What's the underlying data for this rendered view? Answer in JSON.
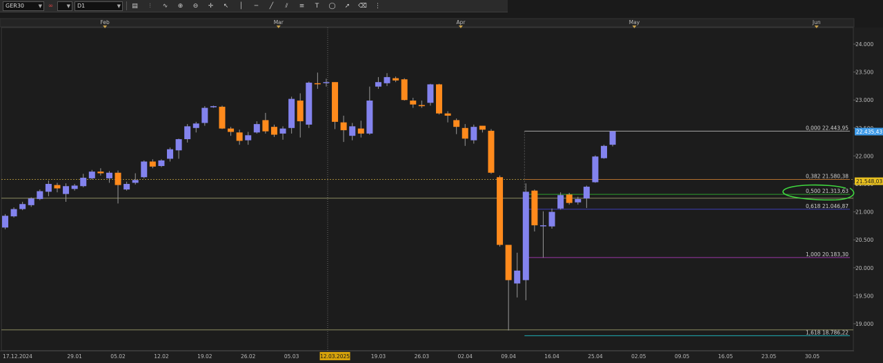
{
  "toolbar": {
    "symbol": "GER30",
    "compare_value": "",
    "timeframe": "D1",
    "tools": [
      {
        "name": "chart-type-icon",
        "glyph": "▤"
      },
      {
        "name": "indicators-icon",
        "glyph": "⫶"
      },
      {
        "name": "oscillators-icon",
        "glyph": "∿"
      },
      {
        "name": "zoom-in-icon",
        "glyph": "⊕"
      },
      {
        "name": "zoom-out-icon",
        "glyph": "⊖"
      },
      {
        "name": "crosshair-icon",
        "glyph": "✛"
      },
      {
        "name": "cursor-icon",
        "glyph": "↖"
      },
      {
        "name": "vertical-line-icon",
        "glyph": "│"
      },
      {
        "name": "horizontal-line-icon",
        "glyph": "─"
      },
      {
        "name": "trend-line-icon",
        "glyph": "╱"
      },
      {
        "name": "channel-icon",
        "glyph": "⫽"
      },
      {
        "name": "fibonacci-icon",
        "glyph": "≡"
      },
      {
        "name": "text-icon",
        "glyph": "T"
      },
      {
        "name": "shapes-icon",
        "glyph": "◯"
      },
      {
        "name": "arrow-icon",
        "glyph": "➚"
      },
      {
        "name": "eraser-icon",
        "glyph": "⌫"
      },
      {
        "name": "more-icon",
        "glyph": "⋮"
      }
    ]
  },
  "chart_data": {
    "type": "candlestick",
    "symbol": "GER30",
    "timeframe": "D1",
    "ylim": [
      18800,
      24200
    ],
    "y_ticks": [
      19000,
      19500,
      20000,
      20500,
      21000,
      21500,
      22000,
      22500,
      23000,
      23500,
      24000
    ],
    "y_tick_labels": [
      "19.000",
      "19.500",
      "20.000",
      "20.500",
      "21.000",
      "21.500",
      "22.000",
      "22.500",
      "23.000",
      "23.500",
      "24.000"
    ],
    "x_labels": [
      "17.12.2024",
      "29.01",
      "05.02",
      "12.02",
      "19.02",
      "26.02",
      "05.03",
      "12.03.2025",
      "19.03",
      "26.03",
      "02.04",
      "09.04",
      "16.04",
      "25.04",
      "02.05",
      "09.05",
      "16.05",
      "23.05",
      "30.05"
    ],
    "x_label_bars": [
      0,
      8,
      13,
      18,
      23,
      28,
      33,
      38,
      43,
      48,
      53,
      58,
      63,
      68,
      73,
      78,
      83,
      88,
      93
    ],
    "highlighted_x_label": "12.03.2025",
    "month_labels": [
      "Feb",
      "Mar",
      "Apr",
      "May",
      "Jun"
    ],
    "month_bars": [
      11.5,
      31.5,
      52.5,
      72.5,
      93.5
    ],
    "bull_color": "#8383ee",
    "bear_color": "#ff8a1c",
    "candles": [
      {
        "o": 20720,
        "h": 20960,
        "l": 20690,
        "c": 20930
      },
      {
        "o": 20920,
        "h": 21080,
        "l": 20900,
        "c": 21050
      },
      {
        "o": 21050,
        "h": 21180,
        "l": 21030,
        "c": 21140
      },
      {
        "o": 21120,
        "h": 21260,
        "l": 21090,
        "c": 21240
      },
      {
        "o": 21230,
        "h": 21400,
        "l": 21210,
        "c": 21370
      },
      {
        "o": 21360,
        "h": 21560,
        "l": 21280,
        "c": 21500
      },
      {
        "o": 21480,
        "h": 21520,
        "l": 21350,
        "c": 21420
      },
      {
        "o": 21320,
        "h": 21510,
        "l": 21180,
        "c": 21460
      },
      {
        "o": 21410,
        "h": 21500,
        "l": 21380,
        "c": 21470
      },
      {
        "o": 21460,
        "h": 21680,
        "l": 21440,
        "c": 21610
      },
      {
        "o": 21600,
        "h": 21750,
        "l": 21580,
        "c": 21720
      },
      {
        "o": 21720,
        "h": 21780,
        "l": 21650,
        "c": 21690
      },
      {
        "o": 21600,
        "h": 21730,
        "l": 21520,
        "c": 21700
      },
      {
        "o": 21700,
        "h": 21740,
        "l": 21150,
        "c": 21480
      },
      {
        "o": 21400,
        "h": 21540,
        "l": 21380,
        "c": 21500
      },
      {
        "o": 21520,
        "h": 21690,
        "l": 21490,
        "c": 21570
      },
      {
        "o": 21620,
        "h": 21920,
        "l": 21600,
        "c": 21900
      },
      {
        "o": 21900,
        "h": 21940,
        "l": 21780,
        "c": 21810
      },
      {
        "o": 21820,
        "h": 21940,
        "l": 21800,
        "c": 21920
      },
      {
        "o": 21950,
        "h": 22150,
        "l": 21900,
        "c": 22120
      },
      {
        "o": 22100,
        "h": 22310,
        "l": 21950,
        "c": 22300
      },
      {
        "o": 22300,
        "h": 22570,
        "l": 22240,
        "c": 22530
      },
      {
        "o": 22500,
        "h": 22610,
        "l": 22420,
        "c": 22580
      },
      {
        "o": 22590,
        "h": 22890,
        "l": 22540,
        "c": 22860
      },
      {
        "o": 22870,
        "h": 22900,
        "l": 22860,
        "c": 22890
      },
      {
        "o": 22880,
        "h": 22900,
        "l": 22480,
        "c": 22490
      },
      {
        "o": 22490,
        "h": 22520,
        "l": 22360,
        "c": 22430
      },
      {
        "o": 22420,
        "h": 22470,
        "l": 22200,
        "c": 22270
      },
      {
        "o": 22280,
        "h": 22430,
        "l": 22200,
        "c": 22370
      },
      {
        "o": 22420,
        "h": 22620,
        "l": 22400,
        "c": 22570
      },
      {
        "o": 22640,
        "h": 22770,
        "l": 22400,
        "c": 22440
      },
      {
        "o": 22520,
        "h": 22560,
        "l": 22340,
        "c": 22380
      },
      {
        "o": 22400,
        "h": 22530,
        "l": 22290,
        "c": 22490
      },
      {
        "o": 22500,
        "h": 23060,
        "l": 22400,
        "c": 23020
      },
      {
        "o": 22990,
        "h": 23120,
        "l": 22330,
        "c": 22620
      },
      {
        "o": 22560,
        "h": 23330,
        "l": 22500,
        "c": 23310
      },
      {
        "o": 23300,
        "h": 23490,
        "l": 23200,
        "c": 23290
      },
      {
        "o": 23310,
        "h": 23380,
        "l": 23240,
        "c": 23320
      },
      {
        "o": 23320,
        "h": 23320,
        "l": 22480,
        "c": 22610
      },
      {
        "o": 22600,
        "h": 22720,
        "l": 22250,
        "c": 22460
      },
      {
        "o": 22360,
        "h": 22590,
        "l": 22280,
        "c": 22530
      },
      {
        "o": 22490,
        "h": 22630,
        "l": 22330,
        "c": 22400
      },
      {
        "o": 22400,
        "h": 23240,
        "l": 22380,
        "c": 22990
      },
      {
        "o": 23240,
        "h": 23410,
        "l": 23200,
        "c": 23320
      },
      {
        "o": 23300,
        "h": 23480,
        "l": 23250,
        "c": 23410
      },
      {
        "o": 23390,
        "h": 23420,
        "l": 23320,
        "c": 23350
      },
      {
        "o": 23370,
        "h": 23390,
        "l": 22990,
        "c": 23000
      },
      {
        "o": 22990,
        "h": 23040,
        "l": 22860,
        "c": 22920
      },
      {
        "o": 22910,
        "h": 22990,
        "l": 22860,
        "c": 22890
      },
      {
        "o": 22950,
        "h": 23290,
        "l": 22900,
        "c": 23280
      },
      {
        "o": 23280,
        "h": 23290,
        "l": 22740,
        "c": 22760
      },
      {
        "o": 22760,
        "h": 22800,
        "l": 22600,
        "c": 22720
      },
      {
        "o": 22640,
        "h": 22670,
        "l": 22390,
        "c": 22520
      },
      {
        "o": 22500,
        "h": 22570,
        "l": 22180,
        "c": 22310
      },
      {
        "o": 22280,
        "h": 22560,
        "l": 22220,
        "c": 22520
      },
      {
        "o": 22540,
        "h": 22540,
        "l": 22420,
        "c": 22470
      },
      {
        "o": 22450,
        "h": 22480,
        "l": 21680,
        "c": 21700
      },
      {
        "o": 21620,
        "h": 21650,
        "l": 20380,
        "c": 20410
      },
      {
        "o": 20410,
        "h": 20410,
        "l": 18880,
        "c": 19780
      },
      {
        "o": 19720,
        "h": 20270,
        "l": 19470,
        "c": 19950
      },
      {
        "o": 19780,
        "h": 21510,
        "l": 19420,
        "c": 21360
      },
      {
        "o": 21380,
        "h": 21400,
        "l": 20650,
        "c": 20760
      },
      {
        "o": 20760,
        "h": 21010,
        "l": 20180,
        "c": 20760
      },
      {
        "o": 20740,
        "h": 21060,
        "l": 20700,
        "c": 21000
      },
      {
        "o": 21060,
        "h": 21350,
        "l": 21040,
        "c": 21300
      },
      {
        "o": 21310,
        "h": 21340,
        "l": 21130,
        "c": 21160
      },
      {
        "o": 21170,
        "h": 21270,
        "l": 21130,
        "c": 21230
      },
      {
        "o": 21240,
        "h": 21470,
        "l": 21070,
        "c": 21450
      },
      {
        "o": 21530,
        "h": 22010,
        "l": 21520,
        "c": 21990
      },
      {
        "o": 21960,
        "h": 22200,
        "l": 21950,
        "c": 22180
      },
      {
        "o": 22200,
        "h": 22440,
        "l": 22170,
        "c": 22440
      }
    ],
    "fibonacci": {
      "levels": [
        {
          "ratio": "0,000",
          "value": "22.443,95",
          "price": 22443.95,
          "color": "#a8a8a8"
        },
        {
          "ratio": "0,382",
          "value": "21.580,38",
          "price": 21580.38,
          "color": "#b5722e"
        },
        {
          "ratio": "0,500",
          "value": "21.313,63",
          "price": 21313.63,
          "color": "#2ea02e"
        },
        {
          "ratio": "0,618",
          "value": "21.046,87",
          "price": 21046.87,
          "color": "#3f3fb8"
        },
        {
          "ratio": "1,000",
          "value": "20.183,30",
          "price": 20183.3,
          "color": "#9a35a8"
        },
        {
          "ratio": "1,618",
          "value": "18.786,22",
          "price": 18786.22,
          "color": "#1eb0b8"
        }
      ],
      "start_bar": 60
    },
    "support_lines": [
      {
        "price": 21245,
        "color": "#8e8e62"
      },
      {
        "price": 18890,
        "color": "#8e8e62"
      }
    ],
    "dotted_line_price": 21580,
    "current_price": {
      "label": "22.435,43",
      "price": 22435.43,
      "color": "#3f9be8"
    },
    "bid_price": {
      "label": "21.548,03",
      "price": 21548.03,
      "color": "#e8c020"
    },
    "crosshair_bar": 37
  }
}
